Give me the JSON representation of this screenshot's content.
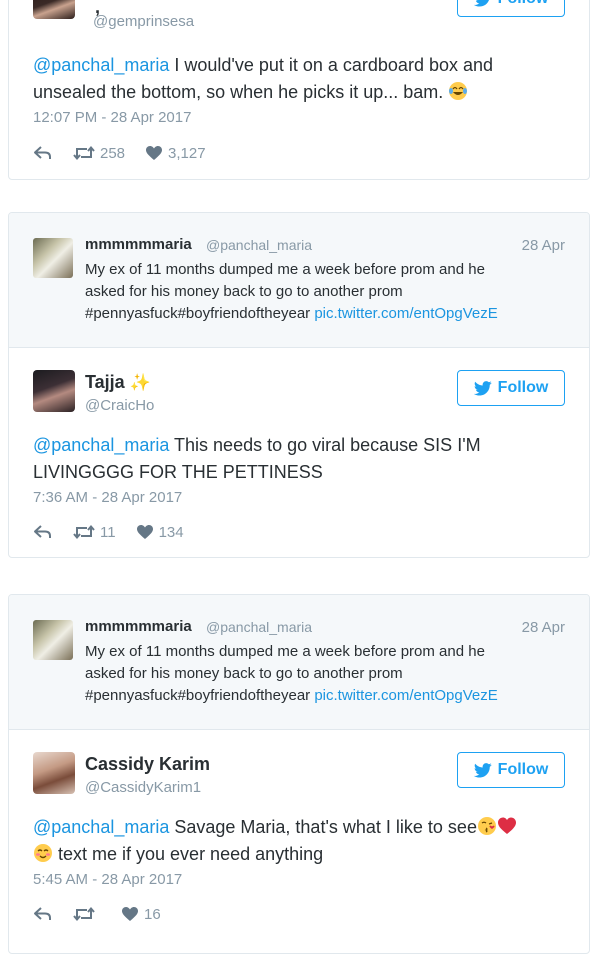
{
  "colors": {
    "link": "#1b95e0",
    "follow_blue": "#1da1f2",
    "muted": "#8899a6",
    "text": "#292f33",
    "heart_red": "#e0245e"
  },
  "tweet1": {
    "handle": "@gemprinsesa",
    "follow_label": "Follow",
    "mention": "@panchal_maria",
    "text_line1": " I would've put it on a cardboard box and",
    "text_line2": "unsealed the bottom, so when he picks it up... bam.",
    "emoji": "face-with-tears-of-joy",
    "time": "12:07 PM - 28 Apr 2017",
    "retweets": "258",
    "likes": "3,127"
  },
  "quoted": {
    "name": "mmmmmmaria",
    "handle": "@panchal_maria",
    "date": "28 Apr",
    "line1": "My ex of 11 months dumped me a week before prom and he",
    "line2": "asked for his money back to go to another prom",
    "hashtags": "#pennyasfuck#boyfriendoftheyear",
    "link": "pic.twitter.com/entOpgVezE"
  },
  "tweet2": {
    "name": "Tajja",
    "name_emoji": "sparkles",
    "handle": "@CraicHo",
    "follow_label": "Follow",
    "mention": "@panchal_maria",
    "text_line1": " This needs to go viral because SIS I'M",
    "text_line2": "LIVINGGGG FOR THE PETTINESS",
    "time": "7:36 AM - 28 Apr 2017",
    "retweets": "11",
    "likes": "134"
  },
  "tweet3": {
    "name": "Cassidy Karim",
    "handle": "@CassidyKarim1",
    "follow_label": "Follow",
    "mention": "@panchal_maria",
    "text_line1": " Savage Maria, that's what I like to see",
    "text_line2": " text me if you ever need anything",
    "emojis": [
      "face-blowing-a-kiss",
      "red-heart",
      "smiling-face-with-blush"
    ],
    "time": "5:45 AM - 28 Apr 2017",
    "likes": "16"
  }
}
